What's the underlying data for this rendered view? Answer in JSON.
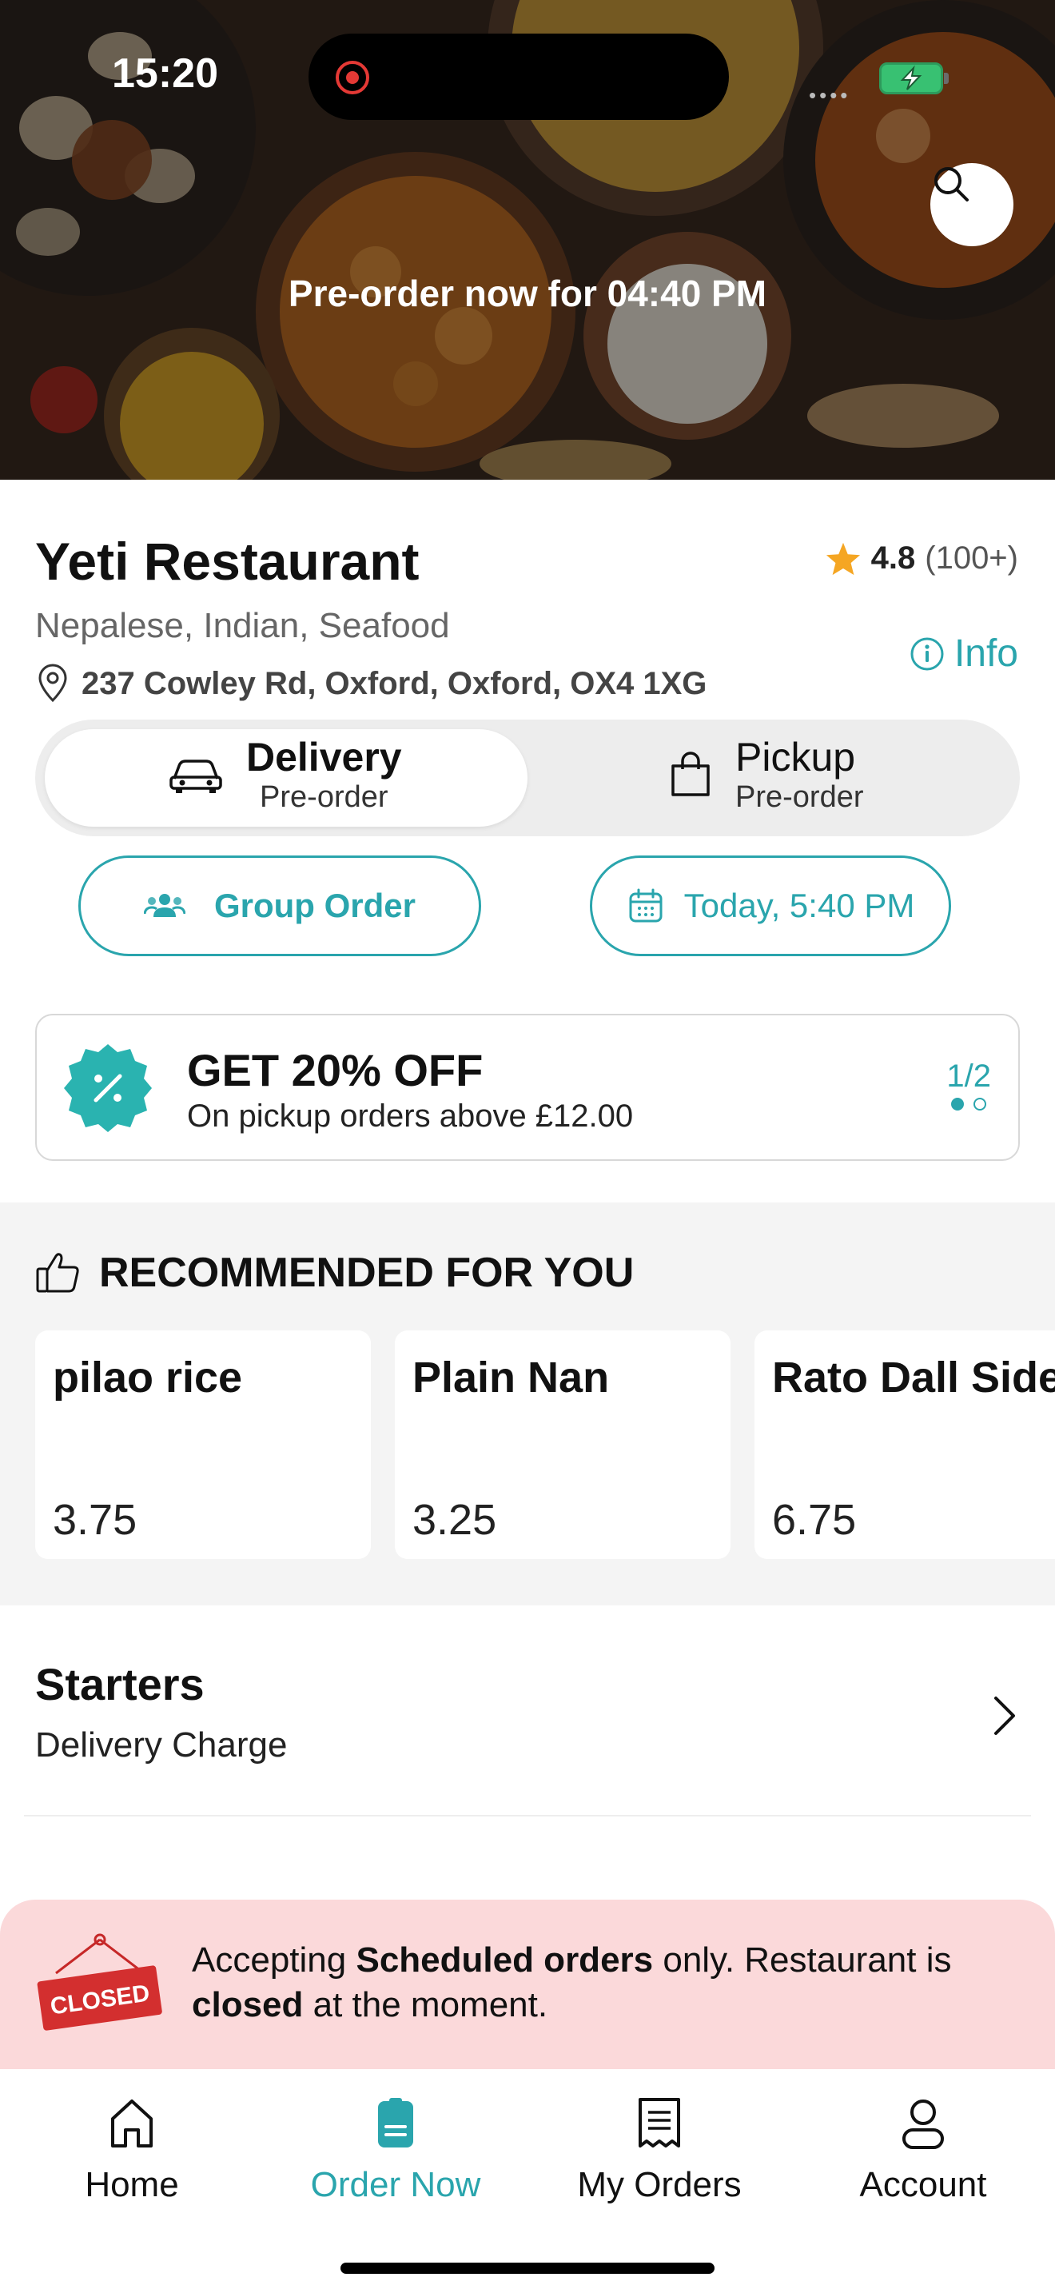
{
  "status_bar": {
    "time": "15:20"
  },
  "hero": {
    "preorder_text": "Pre-order now for 04:40 PM"
  },
  "restaurant": {
    "name": "Yeti Restaurant",
    "rating": "4.8",
    "rating_count": "(100+)",
    "cuisines": "Nepalese, Indian, Seafood",
    "info_label": "Info",
    "address": "237 Cowley Rd, Oxford, Oxford, OX4 1XG"
  },
  "order_type": {
    "delivery_label": "Delivery",
    "delivery_sub": "Pre-order",
    "pickup_label": "Pickup",
    "pickup_sub": "Pre-order",
    "selected": "delivery"
  },
  "actions": {
    "group_order_label": "Group Order",
    "schedule_label": "Today, 5:40 PM"
  },
  "promo": {
    "title": "GET 20% OFF",
    "subtitle": "On pickup orders above £12.00",
    "page_indicator": "1/2"
  },
  "recommended": {
    "heading": "RECOMMENDED FOR YOU",
    "items": [
      {
        "name": "pilao rice",
        "price": "3.75"
      },
      {
        "name": "Plain Nan",
        "price": "3.25"
      },
      {
        "name": "Rato Dall Side",
        "price": "6.75"
      }
    ]
  },
  "category": {
    "title": "Starters",
    "subtitle": "Delivery Charge"
  },
  "closed_notice": {
    "sign_text": "CLOSED",
    "part1": "Accepting ",
    "bold1": "Scheduled orders",
    "part2": " only. Restaurant is ",
    "bold2": "closed",
    "part3": " at the moment."
  },
  "tabbar": {
    "items": [
      {
        "label": "Home",
        "icon": "home-icon"
      },
      {
        "label": "Order Now",
        "icon": "order-icon"
      },
      {
        "label": "My Orders",
        "icon": "receipt-icon"
      },
      {
        "label": "Account",
        "icon": "user-icon"
      }
    ],
    "active": "Order Now"
  },
  "colors": {
    "accent": "#2aa5ad",
    "star": "#f5a623",
    "closed_banner_bg": "#fbd9da",
    "closed_sign": "#d32f2f"
  }
}
